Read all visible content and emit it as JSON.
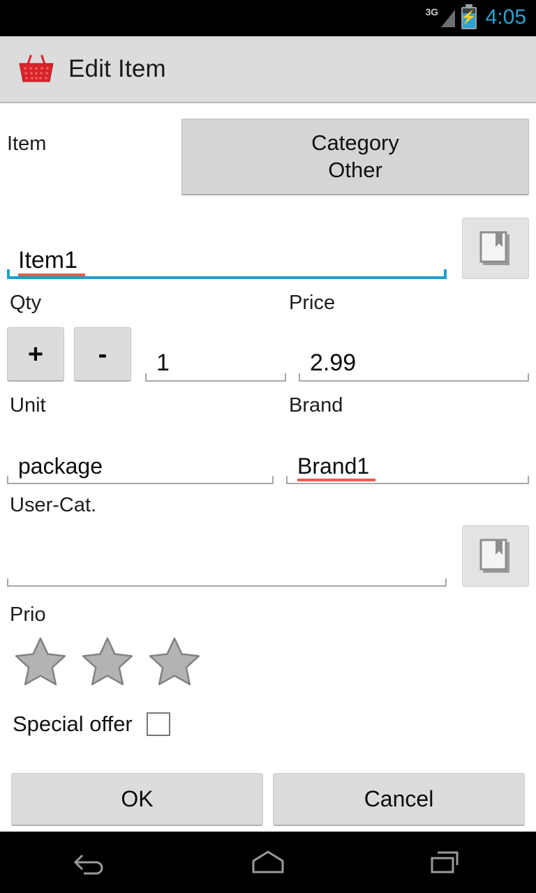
{
  "status_bar": {
    "network_label": "3G",
    "clock": "4:05",
    "signal_icon": "signal-triangle-icon",
    "battery_icon": "battery-charging-icon",
    "clock_color": "#2aa3d4"
  },
  "title_bar": {
    "app_icon": "shopping-basket-icon",
    "title": "Edit Item",
    "background": "#dcdcdc"
  },
  "form": {
    "item_label": "Item",
    "category_button": {
      "heading": "Category",
      "value": "Other"
    },
    "item_name": {
      "value": "Item1",
      "placeholder": "",
      "focused": true,
      "spellcheck_error": true,
      "focus_color": "#1b9fd0",
      "spellcheck_color": "#f05a50"
    },
    "item_name_picker_icon": "bookmark-icon",
    "qty": {
      "label": "Qty",
      "increment_label": "+",
      "decrement_label": "-",
      "value": "1",
      "placeholder": ""
    },
    "price": {
      "label": "Price",
      "value": "2.99",
      "placeholder": ""
    },
    "unit": {
      "label": "Unit",
      "value": "package",
      "placeholder": ""
    },
    "brand": {
      "label": "Brand",
      "value": "Brand1",
      "placeholder": "",
      "spellcheck_error": true
    },
    "user_cat": {
      "label": "User-Cat.",
      "value": "",
      "placeholder": ""
    },
    "user_cat_picker_icon": "bookmark-icon",
    "prio": {
      "label": "Prio",
      "max_stars": 3,
      "filled_stars": 0,
      "star_color": "#b3b3b3",
      "star_outline": "#828282"
    },
    "special_offer": {
      "label": "Special offer",
      "checked": false
    }
  },
  "footer": {
    "ok_label": "OK",
    "cancel_label": "Cancel"
  },
  "nav_bar": {
    "back_icon": "back-arrow-icon",
    "home_icon": "home-icon",
    "recents_icon": "recent-apps-icon"
  }
}
